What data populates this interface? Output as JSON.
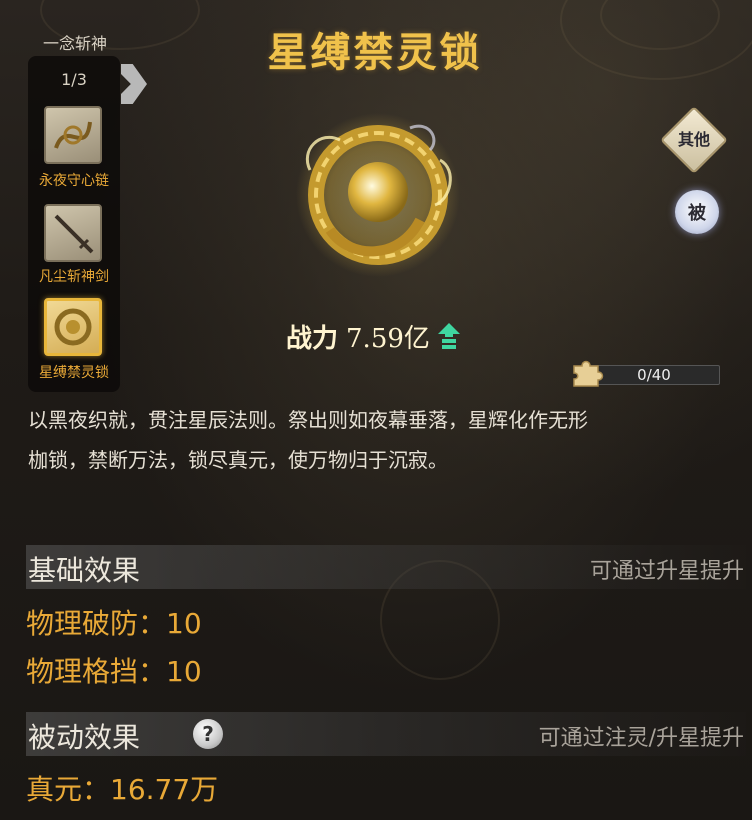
{
  "collection": {
    "label": "一念斩神",
    "page": "1/3",
    "items": [
      {
        "label": "永夜守心链",
        "icon": "chain-icon",
        "selected": false
      },
      {
        "label": "凡尘斩神剑",
        "icon": "sword-icon",
        "selected": false
      },
      {
        "label": "星缚禁灵锁",
        "icon": "dragon-lock-icon",
        "selected": true
      }
    ]
  },
  "item": {
    "title": "星缚禁灵锁",
    "power_label": "战力",
    "power_value": "7.59亿",
    "description_line1": "以黑夜织就，贯注星辰法则。祭出则如夜幕垂落，星辉化作无形",
    "description_line2": "枷锁，禁断万法，锁尽真元，使万物归于沉寂。"
  },
  "side_buttons": {
    "other": "其他",
    "passive": "被"
  },
  "fragment": {
    "text": "0/40",
    "progress": 0
  },
  "basic_effects": {
    "title": "基础效果",
    "hint": "可通过升星提升",
    "stats": [
      "物理破防：10",
      "物理格挡：10"
    ]
  },
  "passive_effects": {
    "title": "被动效果",
    "help": "?",
    "hint": "可通过注灵/升星提升",
    "stats": [
      "真元：16.77万"
    ]
  },
  "colors": {
    "gold": "#f0c24b",
    "stat": "#e9a937",
    "arrow_green": "#3fd6a0"
  }
}
